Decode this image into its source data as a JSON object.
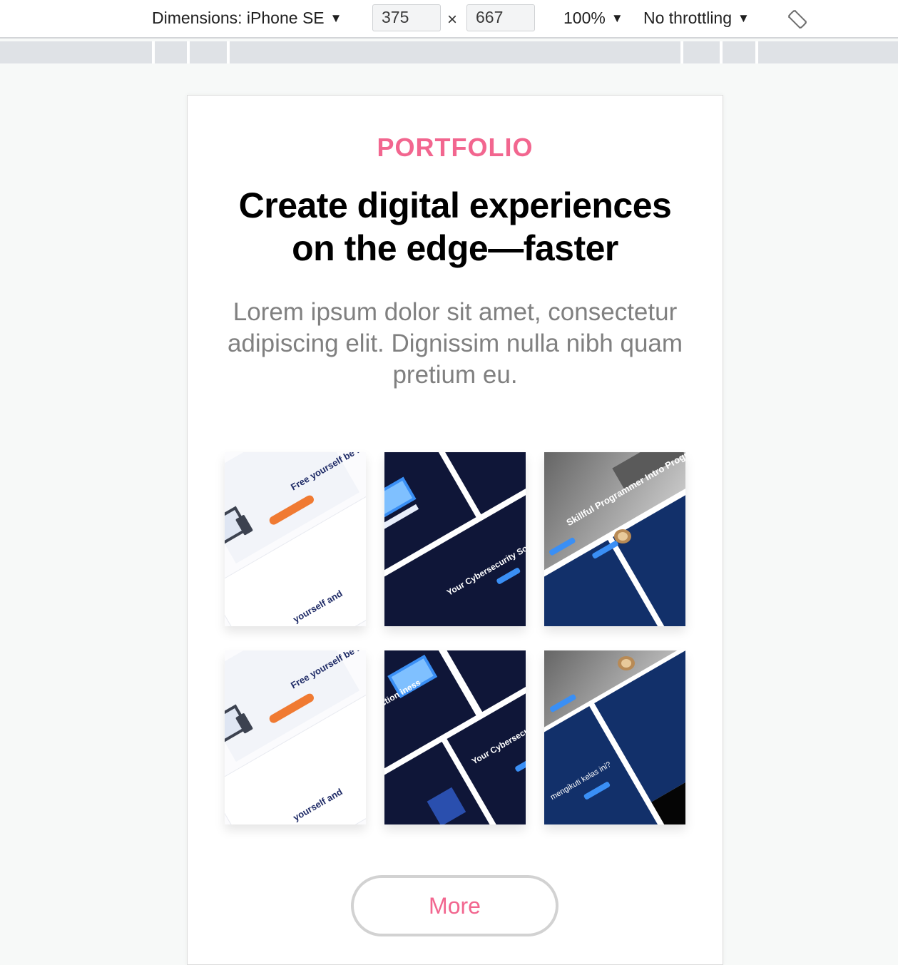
{
  "devtools": {
    "dimensions_label": "Dimensions: iPhone SE",
    "width_value": "375",
    "height_value": "667",
    "times_symbol": "×",
    "zoom_label": "100%",
    "throttling_label": "No throttling",
    "caret": "▼",
    "rotate_icon": "rotate-icon"
  },
  "page": {
    "eyebrow": "PORTFOLIO",
    "headline_line1": "Create digital experiences",
    "headline_line2": "on the edge—faster",
    "lead": "Lorem ipsum dolor sit amet, consectetur adipiscing elit. Dignissim nulla nibh quam pretium eu.",
    "more_label": "More"
  },
  "portfolio": {
    "items": [
      {
        "theme": "light",
        "heading": "Free yourself be more productive",
        "footer_text": "yourself and"
      },
      {
        "theme": "dark",
        "heading": "Your Cybersecurity Solution"
      },
      {
        "theme": "photo",
        "heading": "Skillful Programmer Intro Programming"
      },
      {
        "theme": "light",
        "heading": "Free yourself be more productive",
        "footer_text": "yourself and"
      },
      {
        "theme": "dark",
        "heading": "Your Cybersecurity Solution",
        "side_text": "ction iness"
      },
      {
        "theme": "photo",
        "heading": "mengikuti kelas ini?"
      }
    ]
  },
  "colors": {
    "accent": "#f2668f",
    "navy": "#0f1638",
    "navy_panel": "#12306a",
    "orange": "#f07a32",
    "lead_gray": "#808080"
  }
}
